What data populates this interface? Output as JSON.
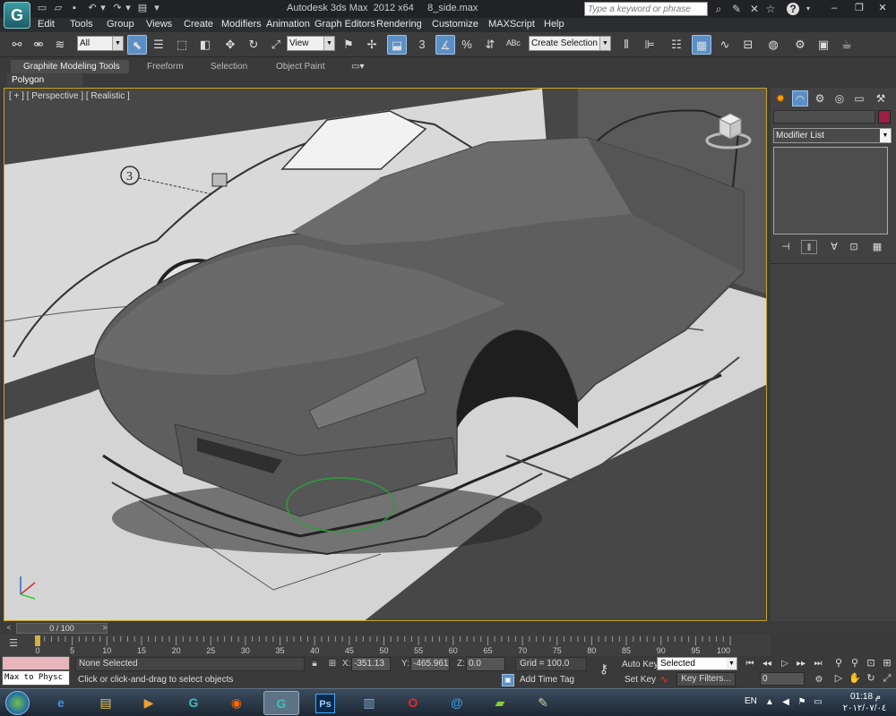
{
  "titlebar": {
    "app_logo": "G",
    "title": "Autodesk 3ds Max  2012 x64     8_side.max",
    "search_placeholder": "Type a keyword or phrase",
    "help_label": "?"
  },
  "menu": [
    "Edit",
    "Tools",
    "Group",
    "Views",
    "Create",
    "Modifiers",
    "Animation",
    "Graph Editors",
    "Rendering",
    "Customize",
    "MAXScript",
    "Help"
  ],
  "toolbar": {
    "filter_value": "All",
    "refcoord_value": "View",
    "selection_set_value": "Create Selection Se",
    "snap_label": "3"
  },
  "ribbon": {
    "tabs": [
      "Graphite Modeling Tools",
      "Freeform",
      "Selection",
      "Object Paint"
    ],
    "panel_label": "Polygon Modeling"
  },
  "viewport": {
    "label": "[ + ] [ Perspective ] [ Realistic ]",
    "blueprint_callout": "3"
  },
  "command_panel": {
    "modifier_list_label": "Modifier List",
    "object_color": "#9c1f45"
  },
  "timeline": {
    "frame_indicator": "0 / 100",
    "ticks": [
      "0",
      "5",
      "10",
      "15",
      "20",
      "25",
      "30",
      "35",
      "40",
      "45",
      "50",
      "55",
      "60",
      "65",
      "70",
      "75",
      "80",
      "85",
      "90",
      "95",
      "100"
    ]
  },
  "status": {
    "script_listener_text": "Max to Physc",
    "selection_text": "None Selected",
    "prompt_text": "Click or click-and-drag to select objects",
    "x_label": "X:",
    "x_value": "-351.13",
    "y_label": "Y:",
    "y_value": "-465.961",
    "z_label": "Z:",
    "z_value": "0.0",
    "grid_text": "Grid = 100.0",
    "add_time_tag": "Add Time Tag",
    "auto_key": "Auto Key",
    "set_key": "Set Key",
    "key_mode_value": "Selected",
    "key_filters": "Key Filters...",
    "current_frame": "0"
  },
  "taskbar": {
    "ps_label": "Ps",
    "lang": "EN",
    "time": "01:18 م",
    "date": "٢٠١٢/٠٧/٠٤"
  },
  "colors": {
    "viewport_border": "#c9a227",
    "selection_highlight": "#5b8fc5"
  }
}
